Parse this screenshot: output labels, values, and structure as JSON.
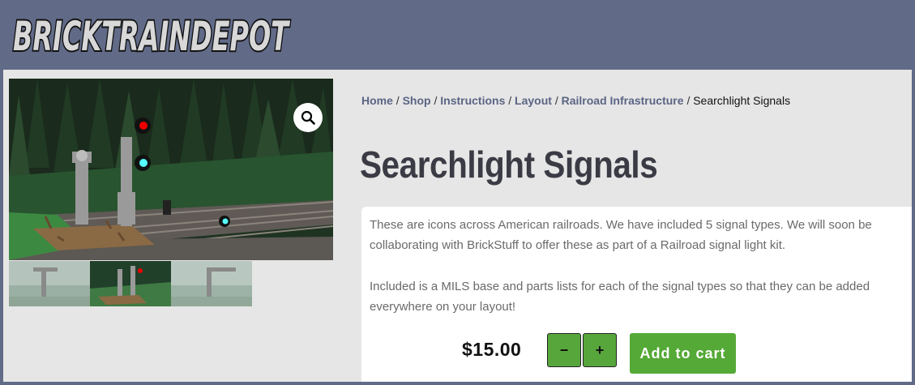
{
  "site": {
    "logo_text": "BRICKTRAINDEPOT",
    "brand_color": "#616b88"
  },
  "breadcrumb": {
    "items": [
      "Home",
      "Shop",
      "Instructions",
      "Layout",
      "Railroad Infrastructure"
    ],
    "separator": "/",
    "current": "Searchlight Signals"
  },
  "product": {
    "title": "Searchlight Signals",
    "description_1": "These are icons across American railroads. We have included 5 signal types. We will soon be collaborating with BrickStuff to offer these as part of a Railroad signal light kit.",
    "description_2": "Included is a MILS base and parts lists for each of the signal types so that they can be added everywhere on your layout!",
    "price": "$15.00",
    "qty_minus": "−",
    "qty_plus": "+",
    "add_to_cart": "Add to cart"
  },
  "gallery": {
    "zoom_icon": "magnifier-icon",
    "thumbnail_count": 3
  },
  "colors": {
    "button_green": "#55a936",
    "title": "#3a3b44",
    "link": "#5b6584"
  }
}
